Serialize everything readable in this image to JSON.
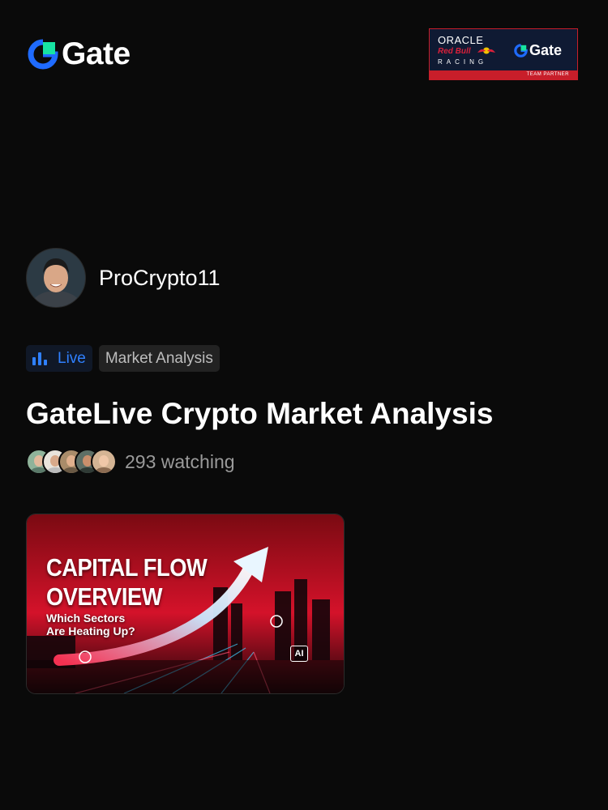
{
  "header": {
    "brand": "Gate",
    "partner_badge": {
      "line1": "ORACLE",
      "line2": "Red Bull",
      "line3": "RACING",
      "brand": "Gate",
      "strip_text": "TEAM PARTNER"
    }
  },
  "host": {
    "name": "ProCrypto11"
  },
  "tags": {
    "live_label": "Live",
    "category_label": "Market Analysis"
  },
  "stream": {
    "title": "GateLive Crypto Market Analysis",
    "watching_text": "293 watching"
  },
  "thumbnail": {
    "headline": "CAPITAL FLOW\nOVERVIEW",
    "subheadline": "Which Sectors\nAre Heating Up?",
    "badge": "AI"
  },
  "colors": {
    "background": "#0a0a0a",
    "live_accent": "#2f80ff",
    "brand_blue": "#1f6bff",
    "brand_green": "#17e4a2",
    "partner_red": "#c81e2a"
  }
}
